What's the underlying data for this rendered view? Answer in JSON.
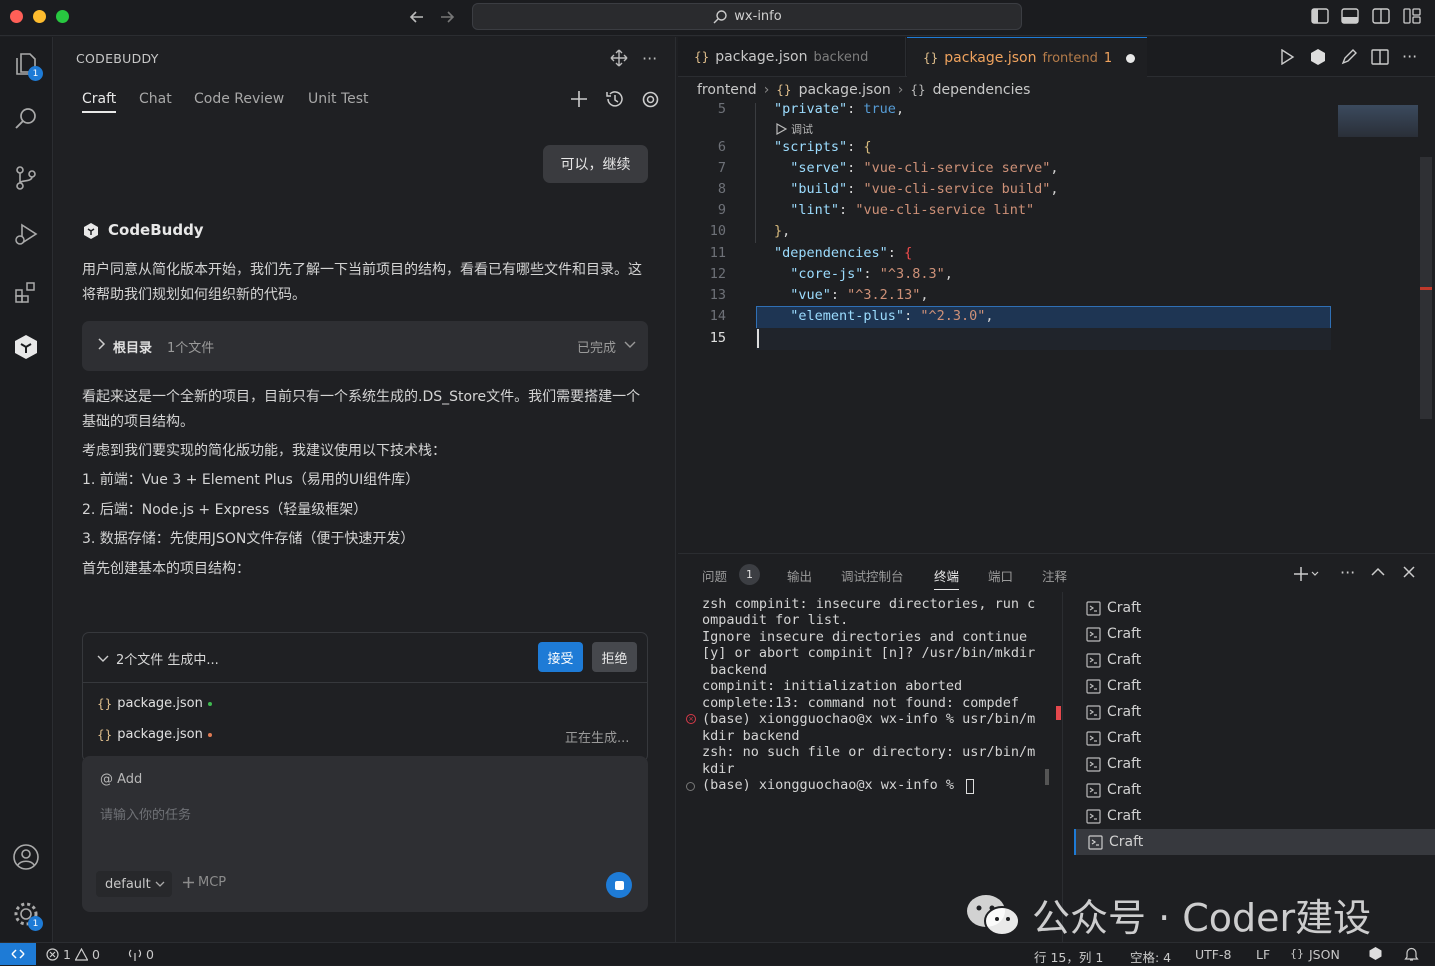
{
  "window": {
    "search": "wx-info"
  },
  "panel": {
    "title": "CODEBUDDY",
    "tabs": [
      "Craft",
      "Chat",
      "Code Review",
      "Unit Test"
    ],
    "user_msg": "可以，继续",
    "assistant_name": "CodeBuddy",
    "para1": "用户同意从简化版本开始，我们先了解一下当前项目的结构，看看已有哪些文件和目录。这将帮助我们规划如何组织新的代码。",
    "folder": {
      "label": "根目录",
      "count": "1个文件",
      "status": "已完成"
    },
    "para2": "看起来这是一个全新的项目，目前只有一个系统生成的.DS_Store文件。我们需要搭建一个基础的项目结构。",
    "para3": "考虑到我们要实现的简化版功能，我建议使用以下技术栈：",
    "list": [
      "1. 前端：Vue 3 + Element Plus（易用的UI组件库）",
      "2. 后端：Node.js + Express（轻量级框架）",
      "3. 数据存储：先使用JSON文件存储（便于快速开发）"
    ],
    "para4": "首先创建基本的项目结构：",
    "gen": {
      "title": "2个文件 生成中...",
      "accept": "接受",
      "reject": "拒绝",
      "file1": "package.json",
      "file2": "package.json",
      "generating": "正在生成..."
    },
    "input": {
      "add": "@ Add",
      "placeholder": "请输入你的任务",
      "model": "default",
      "mcp": "MCP"
    }
  },
  "editor": {
    "tabs": [
      {
        "name": "package.json",
        "desc": "backend"
      },
      {
        "name": "package.json",
        "desc": "frontend",
        "count": "1"
      }
    ],
    "breadcrumb": [
      "frontend",
      "package.json",
      "dependencies"
    ],
    "lines": [
      "5",
      "6",
      "7",
      "8",
      "9",
      "10",
      "11",
      "12",
      "13",
      "14",
      "15"
    ],
    "debug": "调试"
  },
  "terminal": {
    "tabs": [
      "问题",
      "输出",
      "调试控制台",
      "终端",
      "端口",
      "注释"
    ],
    "problems_count": "1",
    "lines": [
      "zsh compinit: insecure directories, run c",
      "ompaudit for list.",
      "Ignore insecure directories and continue",
      "[y] or abort compinit [n]? /usr/bin/mkdir",
      " backend",
      "compinit: initialization aborted",
      "complete:13: command not found: compdef",
      "(base) xiongguochao@x wx-info % usr/bin/m",
      "kdir backend",
      "zsh: no such file or directory: usr/bin/m",
      "kdir",
      "(base) xiongguochao@x wx-info % "
    ],
    "sessions": [
      "Craft",
      "Craft",
      "Craft",
      "Craft",
      "Craft",
      "Craft",
      "Craft",
      "Craft",
      "Craft",
      "Craft"
    ]
  },
  "status": {
    "errors": "1",
    "warnings": "0",
    "ports": "0",
    "position": "行 15，列 1",
    "spaces": "空格: 4",
    "encoding": "UTF-8",
    "eol": "LF",
    "language": "JSON"
  },
  "watermark": "公众号 · Coder建设"
}
